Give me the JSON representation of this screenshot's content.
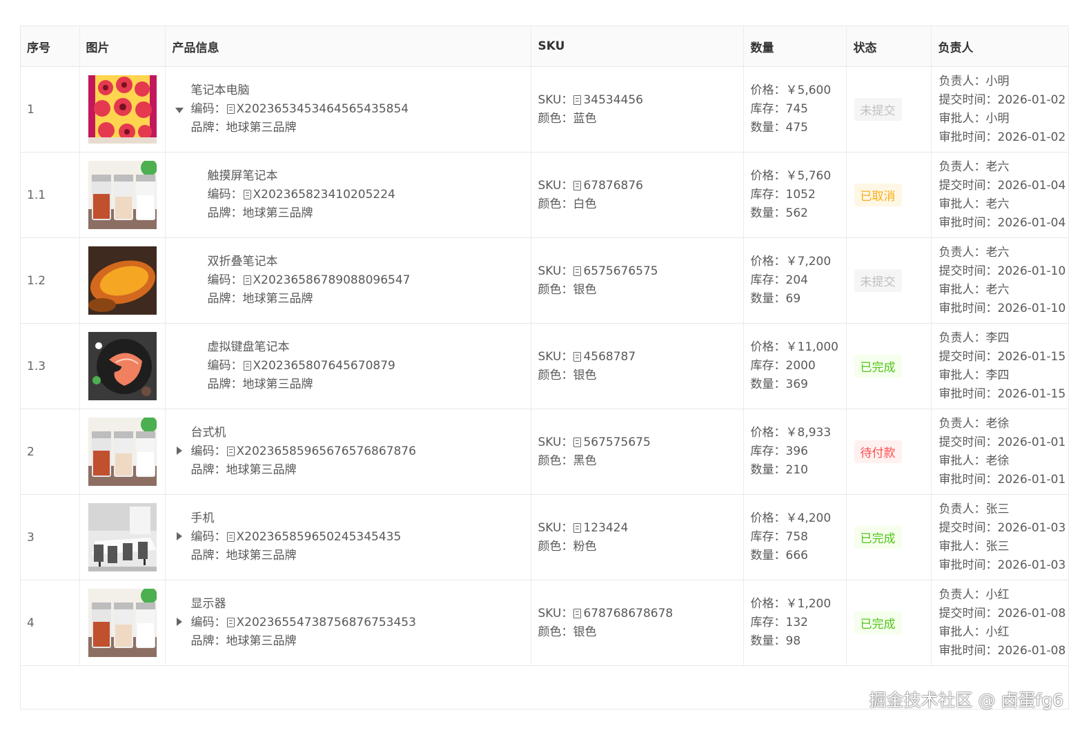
{
  "headers": {
    "index": "序号",
    "image": "图片",
    "product": "产品信息",
    "sku": "SKU",
    "quantity": "数量",
    "status": "状态",
    "owner": "负责人"
  },
  "labels": {
    "code": "编码：",
    "brand": "品牌：",
    "sku": "SKU：",
    "color": "颜色：",
    "price": "价格：",
    "stock": "库存：",
    "qty": "数量：",
    "owner": "负责人：",
    "submit": "提交时间：",
    "approver": "审批人：",
    "approve_time": "审批时间："
  },
  "rows": [
    {
      "index": "1",
      "name": "笔记本电脑",
      "code": "X2023653453464565435854",
      "brand": "地球第三品牌",
      "sku": "34534456",
      "color": "蓝色",
      "price": "￥5,600",
      "stock": "745",
      "qty": "475",
      "status": "未提交",
      "owner": "小明",
      "submit": "2026-01-02",
      "approver": "小明",
      "approve_time": "2026-01-02",
      "image": "fruit-in-mesh-photo"
    },
    {
      "index": "1.1",
      "name": "触摸屏笔记本",
      "code": "X2023658234102​05224",
      "brand": "地球第三品牌",
      "sku": "67876876",
      "color": "白色",
      "price": "￥5,760",
      "stock": "1052",
      "qty": "562",
      "status": "已取消",
      "owner": "老六",
      "submit": "2026-01-04",
      "approver": "老六",
      "approve_time": "2026-01-04",
      "image": "spice-jars-photo"
    },
    {
      "index": "1.2",
      "name": "双折叠笔记本",
      "code": "X2023658678908809​6547",
      "brand": "地球第三品牌",
      "sku": "6575676575",
      "color": "银色",
      "price": "￥7,200",
      "stock": "204",
      "qty": "69",
      "status": "未提交",
      "owner": "老六",
      "submit": "2026-01-10",
      "approver": "老六",
      "approve_time": "2026-01-10",
      "image": "roasted-sweet-potato-photo"
    },
    {
      "index": "1.3",
      "name": "虚拟键盘笔记本",
      "code": "X2023658076456708​79",
      "brand": "地球第三品牌",
      "sku": "4568787",
      "color": "银色",
      "price": "￥11,000",
      "stock": "2000",
      "qty": "369",
      "status": "已完成",
      "owner": "李四",
      "submit": "2026-01-15",
      "approver": "李四",
      "approve_time": "2026-01-15",
      "image": "salmon-steak-photo"
    },
    {
      "index": "2",
      "name": "台式机",
      "code": "X2023658596567657686​7876",
      "brand": "地球第三品牌",
      "sku": "567575675",
      "color": "黑色",
      "price": "￥8,933",
      "stock": "396",
      "qty": "210",
      "status": "待付款",
      "owner": "老徐",
      "submit": "2026-01-01",
      "approver": "老徐",
      "approve_time": "2026-01-01",
      "image": "spice-jars-photo"
    },
    {
      "index": "3",
      "name": "手机",
      "code": "X20236585965024534​5435",
      "brand": "地球第三品牌",
      "sku": "123424",
      "color": "粉色",
      "price": "￥4,200",
      "stock": "758",
      "qty": "666",
      "status": "已完成",
      "owner": "张三",
      "submit": "2026-01-03",
      "approver": "张三",
      "approve_time": "2026-01-03",
      "image": "dining-table-photo"
    },
    {
      "index": "4",
      "name": "显示器",
      "code": "X202365547387568767​53453",
      "brand": "地球第三品牌",
      "sku": "678768678678",
      "color": "银色",
      "price": "￥1,200",
      "stock": "132",
      "qty": "98",
      "status": "已完成",
      "owner": "小红",
      "submit": "2026-01-08",
      "approver": "小红",
      "approve_time": "2026-01-08",
      "image": "spice-jars-photo"
    }
  ],
  "status_colors": {
    "未提交": "#bfbfbf",
    "已取消": "#faad14",
    "已完成": "#52c41a",
    "待付款": "#ff4d4f"
  },
  "status_bg": {
    "未提交": "#f5f5f5",
    "已取消": "#fff7e6",
    "已完成": "#f6ffed",
    "待付款": "#fff1f0"
  },
  "watermark": "掘金技术社区 @ 卤蛋fg6"
}
